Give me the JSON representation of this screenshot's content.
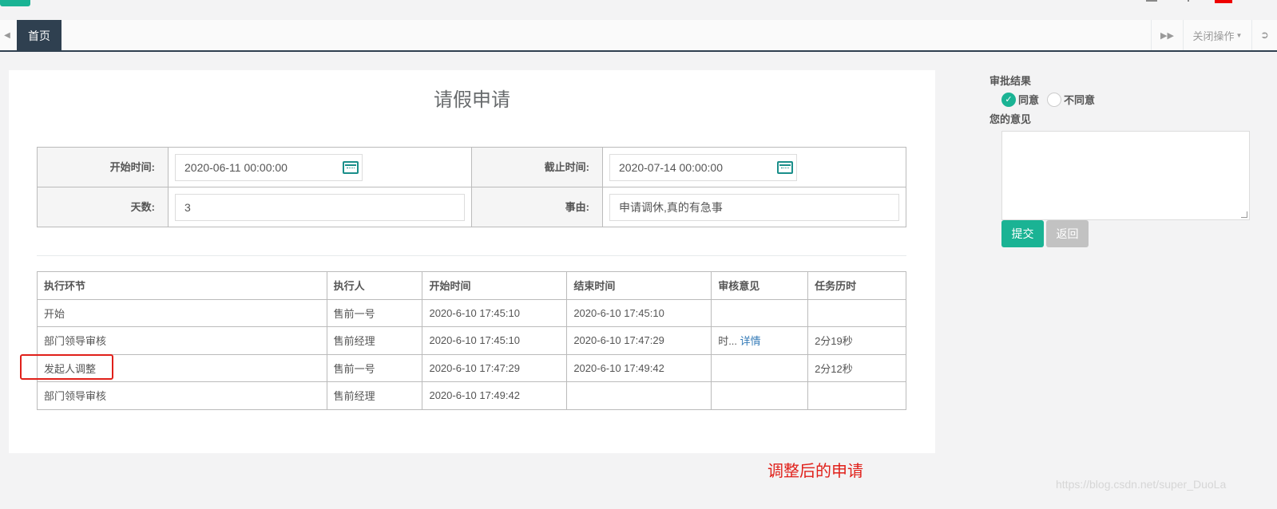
{
  "tabbar": {
    "home_label": "首页",
    "close_ops_label": "关闭操作"
  },
  "form": {
    "title": "请假申请",
    "start_label": "开始时间:",
    "start_value": "2020-06-11 00:00:00",
    "end_label": "截止时间:",
    "end_value": "2020-07-14 00:00:00",
    "days_label": "天数:",
    "days_value": "3",
    "reason_label": "事由:",
    "reason_value": "申请调休,真的有急事"
  },
  "task_table": {
    "headers": [
      "执行环节",
      "执行人",
      "开始时间",
      "结束时间",
      "审核意见",
      "任务历时"
    ],
    "rows": [
      [
        "开始",
        "售前一号",
        "2020-6-10 17:45:10",
        "2020-6-10 17:45:10",
        "",
        ""
      ],
      [
        "部门领导审核",
        "售前经理",
        "2020-6-10 17:45:10",
        "2020-6-10 17:47:29",
        "时...",
        "2分19秒"
      ],
      [
        "发起人调整",
        "售前一号",
        "2020-6-10 17:47:29",
        "2020-6-10 17:49:42",
        "",
        "2分12秒"
      ],
      [
        "部门领导审核",
        "售前经理",
        "2020-6-10 17:49:42",
        "",
        "",
        ""
      ]
    ],
    "detail_link": "详情"
  },
  "approval": {
    "result_label": "审批结果",
    "agree_label": "同意",
    "disagree_label": "不同意",
    "selected": "同意",
    "opinion_label": "您的意见",
    "opinion_value": "",
    "submit_label": "提交",
    "back_label": "返回"
  },
  "annotation": "调整后的申请",
  "watermark": "https://blog.csdn.net/super_DuoLa",
  "colors": {
    "accent": "#1ab394",
    "nav_dark": "#2f4050",
    "annotation_red": "#e0201a",
    "link_blue": "#337ab7"
  }
}
